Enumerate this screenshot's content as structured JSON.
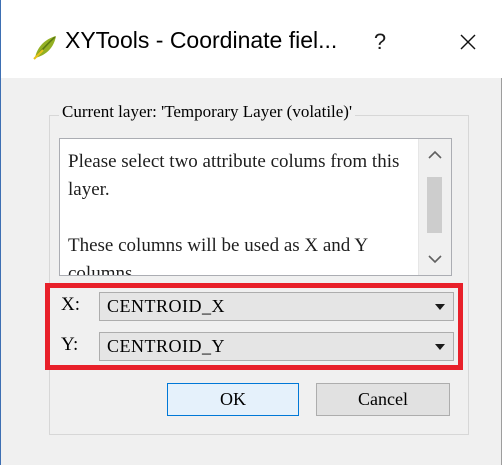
{
  "window": {
    "title": "XYTools - Coordinate fiel...",
    "help_label": "?",
    "app_icon": "qgis-leaf-icon",
    "close_icon": "close-icon"
  },
  "group": {
    "legend": "Current layer: 'Temporary Layer (volatile)'"
  },
  "info": {
    "paragraph1": "Please select two attribute colums from this layer.",
    "paragraph2": "These columns will be used as X and Y columns"
  },
  "fields": {
    "x_label": "X:",
    "x_value": "CENTROID_X",
    "y_label": "Y:",
    "y_value": "CENTROID_Y"
  },
  "buttons": {
    "ok": "OK",
    "cancel": "Cancel"
  },
  "colors": {
    "highlight": "#e8202a",
    "ok_border": "#0078d7"
  }
}
